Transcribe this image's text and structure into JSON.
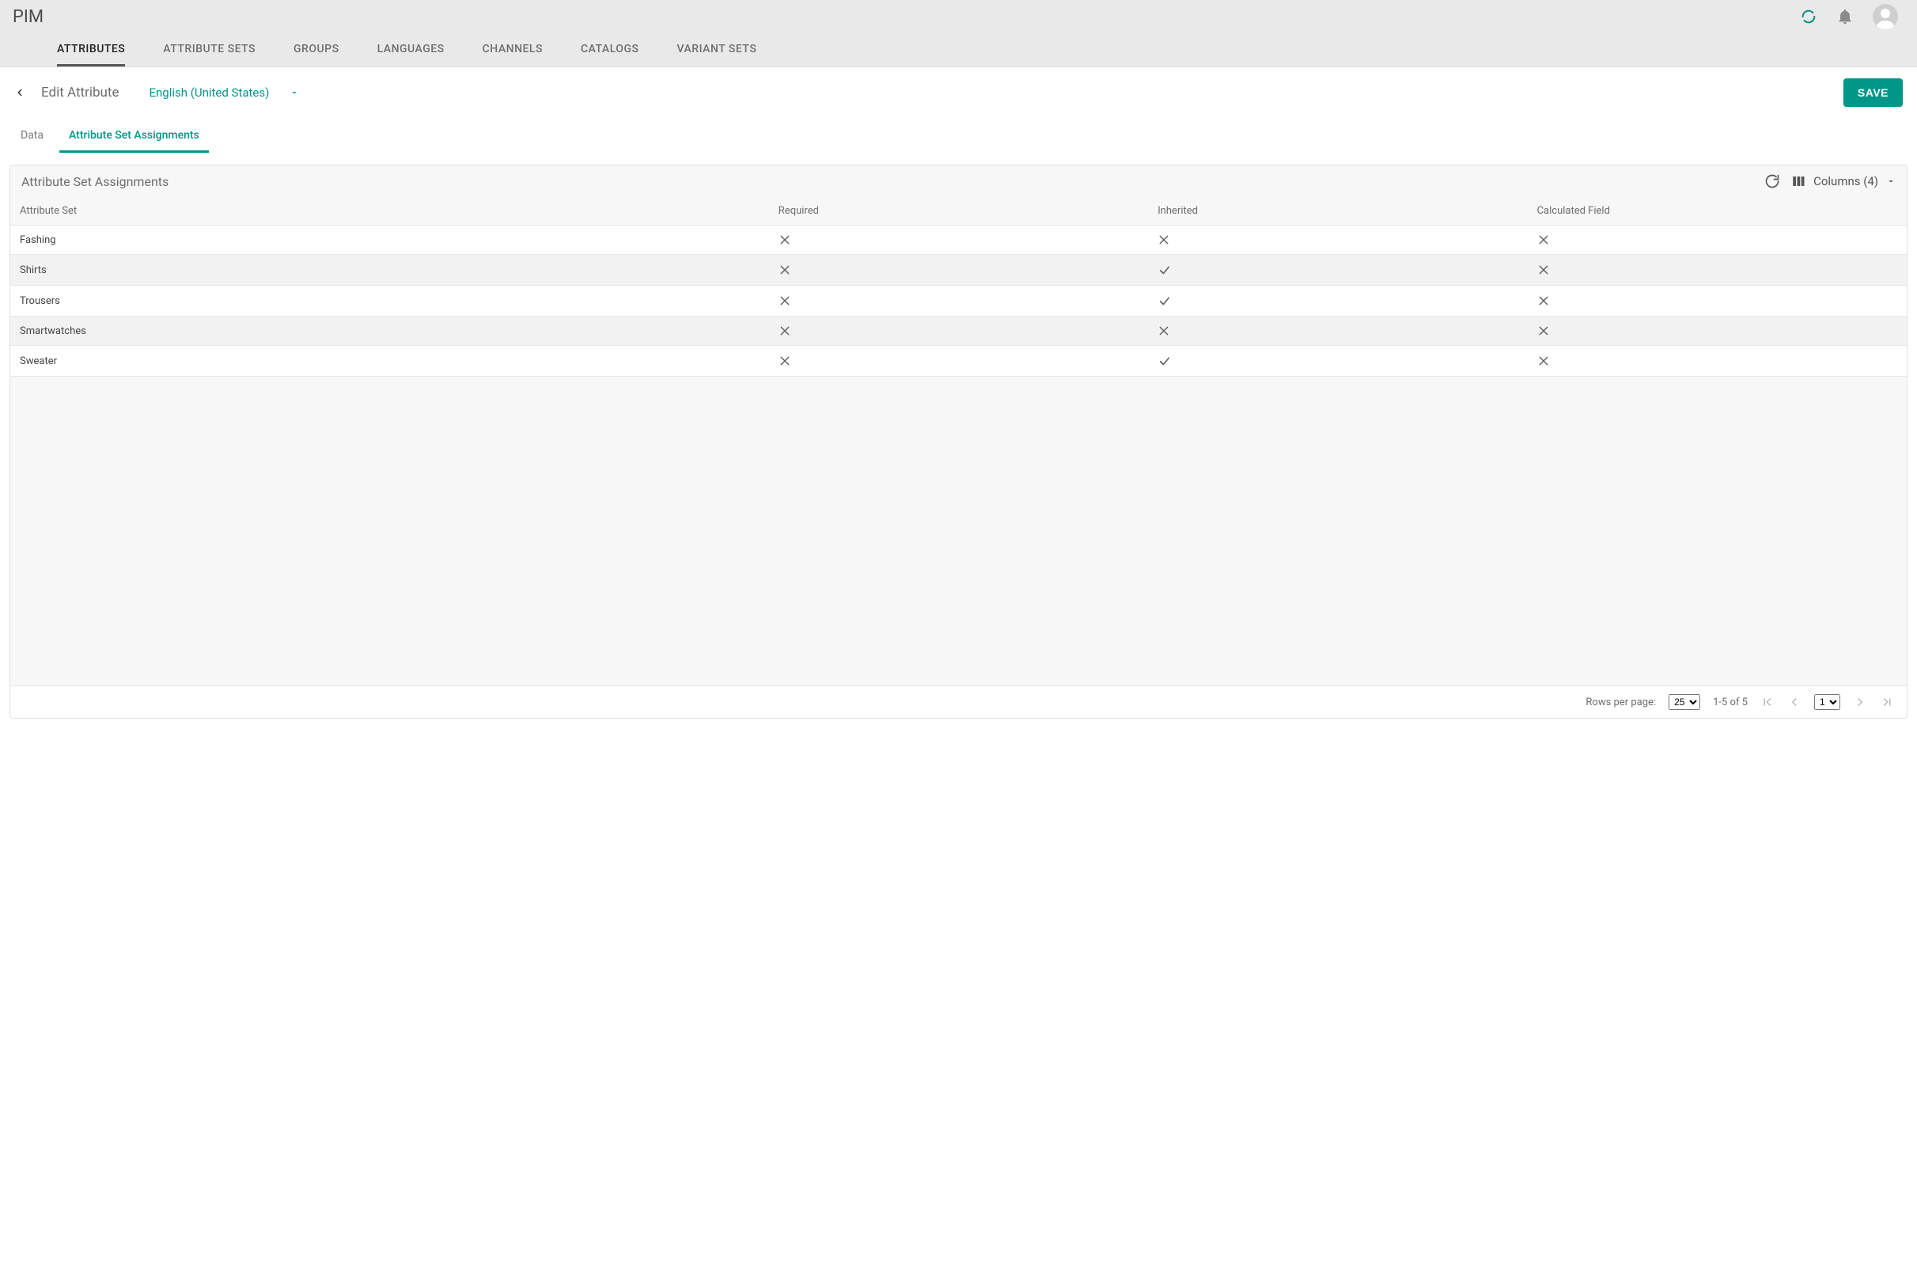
{
  "app": {
    "title": "PIM"
  },
  "nav": {
    "tabs": [
      {
        "label": "ATTRIBUTES",
        "active": true
      },
      {
        "label": "ATTRIBUTE SETS"
      },
      {
        "label": "GROUPS"
      },
      {
        "label": "LANGUAGES"
      },
      {
        "label": "CHANNELS"
      },
      {
        "label": "CATALOGS"
      },
      {
        "label": "VARIANT SETS"
      }
    ]
  },
  "subheader": {
    "breadcrumb": "Edit Attribute",
    "language": "English (United States)",
    "save_label": "SAVE"
  },
  "sub_tabs": [
    {
      "label": "Data"
    },
    {
      "label": "Attribute Set Assignments",
      "active": true
    }
  ],
  "panel": {
    "title": "Attribute Set Assignments",
    "columns_label": "Columns (4)"
  },
  "table": {
    "columns": [
      {
        "label": "Attribute Set"
      },
      {
        "label": "Required"
      },
      {
        "label": "Inherited"
      },
      {
        "label": "Calculated Field"
      }
    ],
    "rows": [
      {
        "name": "Fashing",
        "required": false,
        "inherited": false,
        "calculated": false
      },
      {
        "name": "Shirts",
        "required": false,
        "inherited": true,
        "calculated": false
      },
      {
        "name": "Trousers",
        "required": false,
        "inherited": true,
        "calculated": false
      },
      {
        "name": "Smartwatches",
        "required": false,
        "inherited": false,
        "calculated": false
      },
      {
        "name": "Sweater",
        "required": false,
        "inherited": true,
        "calculated": false
      }
    ]
  },
  "pagination": {
    "rows_per_page_label": "Rows per page:",
    "rows_per_page_value": "25",
    "range_text": "1-5 of 5",
    "page_value": "1"
  }
}
